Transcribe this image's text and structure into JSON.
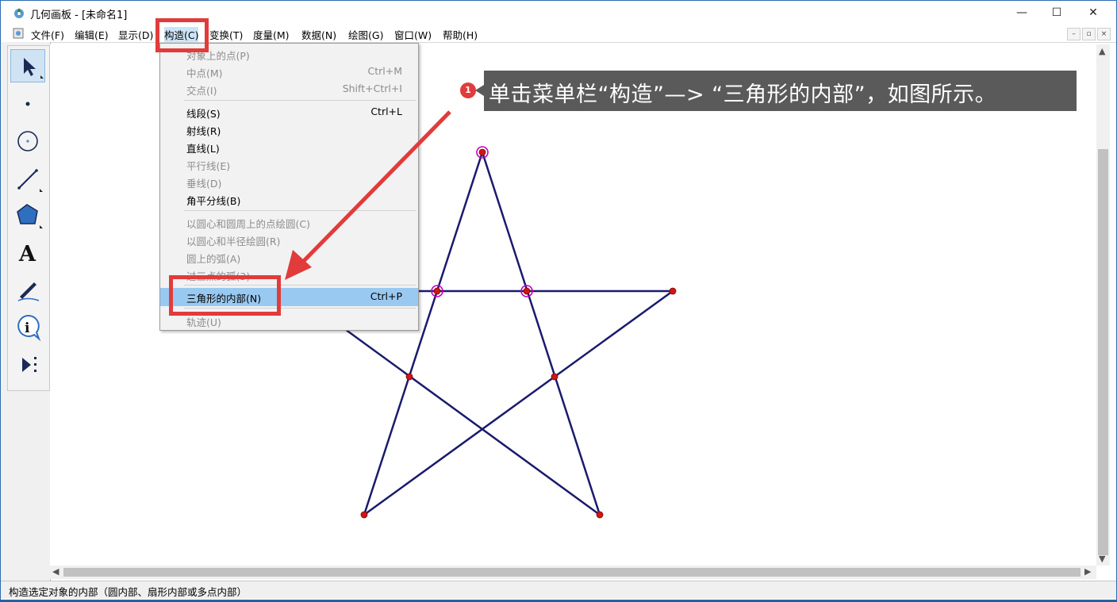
{
  "window": {
    "title": "几何画板 - [未命名1]",
    "minimize": "—",
    "maximize": "☐",
    "close": "✕"
  },
  "menubar": {
    "items": [
      {
        "label": "文件(F)"
      },
      {
        "label": "编辑(E)"
      },
      {
        "label": "显示(D)"
      },
      {
        "label": "构造(C)",
        "active": true
      },
      {
        "label": "变换(T)"
      },
      {
        "label": "度量(M)"
      },
      {
        "label": "数据(N)"
      },
      {
        "label": "绘图(G)"
      },
      {
        "label": "窗口(W)"
      },
      {
        "label": "帮助(H)"
      }
    ],
    "doc_min": "–",
    "doc_restore": "▫",
    "doc_close": "×"
  },
  "toolbox": {
    "tools": [
      {
        "name": "arrow-select-icon",
        "active": true
      },
      {
        "name": "point-icon"
      },
      {
        "name": "compass-circle-icon"
      },
      {
        "name": "segment-straightedge-icon"
      },
      {
        "name": "polygon-icon"
      },
      {
        "name": "text-icon",
        "glyph": "A"
      },
      {
        "name": "marker-pen-icon"
      },
      {
        "name": "information-icon",
        "glyph": "i"
      },
      {
        "name": "custom-tool-icon"
      }
    ]
  },
  "construct_menu": {
    "groups": [
      [
        {
          "label": "对象上的点(P)",
          "shortcut": "",
          "enabled": false
        },
        {
          "label": "中点(M)",
          "shortcut": "Ctrl+M",
          "enabled": false
        },
        {
          "label": "交点(I)",
          "shortcut": "Shift+Ctrl+I",
          "enabled": false
        }
      ],
      [
        {
          "label": "线段(S)",
          "shortcut": "Ctrl+L",
          "enabled": true
        },
        {
          "label": "射线(R)",
          "shortcut": "",
          "enabled": true
        },
        {
          "label": "直线(L)",
          "shortcut": "",
          "enabled": true
        },
        {
          "label": "平行线(E)",
          "shortcut": "",
          "enabled": false
        },
        {
          "label": "垂线(D)",
          "shortcut": "",
          "enabled": false
        },
        {
          "label": "角平分线(B)",
          "shortcut": "",
          "enabled": true
        }
      ],
      [
        {
          "label": "以圆心和圆周上的点绘圆(C)",
          "shortcut": "",
          "enabled": false
        },
        {
          "label": "以圆心和半径绘圆(R)",
          "shortcut": "",
          "enabled": false
        },
        {
          "label": "圆上的弧(A)",
          "shortcut": "",
          "enabled": false
        },
        {
          "label": "过三点的弧(3)",
          "shortcut": "",
          "enabled": false
        }
      ],
      [
        {
          "label": "三角形的内部(N)",
          "shortcut": "Ctrl+P",
          "enabled": true,
          "highlighted": true
        }
      ],
      [
        {
          "label": "轨迹(U)",
          "shortcut": "",
          "enabled": false
        }
      ]
    ]
  },
  "annotation": {
    "step": "1",
    "text": "单击菜单栏“构造”—> “三角形的内部”，如图所示。"
  },
  "statusbar": {
    "text": "构造选定对象的内部（圆内部、扇形内部或多点内部）"
  },
  "scroll": {
    "up": "▲",
    "down": "▼",
    "left": "◀",
    "right": "▶"
  },
  "colors": {
    "segment": "#1a1a6e",
    "point": "#d01515",
    "selection": "#c000c0",
    "menu_highlight": "#99c9f0",
    "annotation_red": "#e23b3b"
  }
}
